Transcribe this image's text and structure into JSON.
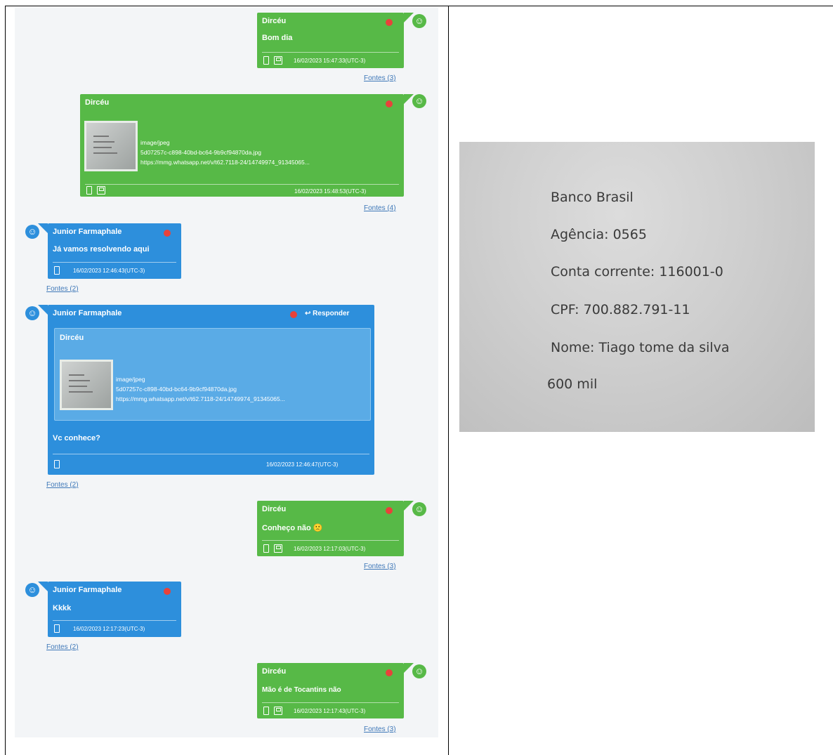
{
  "chat": {
    "messages": [
      {
        "sender": "Dircéu",
        "text": "Bom dia",
        "time": "16/02/2023 15:47:33(UTC-3)",
        "fontes": "Fontes (3)"
      },
      {
        "sender": "Dircéu",
        "attachment": {
          "type": "image/jpeg",
          "filename": "5d07257c-c898-40bd-bc64-9b9cf94870da.jpg",
          "url": "https://mmg.whatsapp.net/v/t62.7118-24/14749974_91345065..."
        },
        "time": "16/02/2023 15:48:53(UTC-3)",
        "fontes": "Fontes (4)"
      },
      {
        "sender": "Junior Farmaphale",
        "text": "Já vamos resolvendo aqui",
        "time": "16/02/2023 12:46:43(UTC-3)",
        "fontes": "Fontes (2)"
      },
      {
        "sender": "Junior Farmaphale",
        "reply_label": "Responder",
        "quoted_sender": "Dircéu",
        "attachment": {
          "type": "image/jpeg",
          "filename": "5d07257c-c898-40bd-bc64-9b9cf94870da.jpg",
          "url": "https://mmg.whatsapp.net/v/t62.7118-24/14749974_91345065..."
        },
        "text": "Vc conhece?",
        "time": "16/02/2023 12:46:47(UTC-3)",
        "fontes": "Fontes (2)"
      },
      {
        "sender": "Dircéu",
        "text": "Conheço não 🙁",
        "time": "16/02/2023 12:17:03(UTC-3)",
        "fontes": "Fontes (3)"
      },
      {
        "sender": "Junior Farmaphale",
        "text": "Kkkk",
        "time": "16/02/2023 12:17:23(UTC-3)",
        "fontes": "Fontes (2)"
      },
      {
        "sender": "Dircéu",
        "text": "Mão é de Tocantins não",
        "time": "16/02/2023 12:17:43(UTC-3)",
        "fontes": "Fontes (3)"
      }
    ]
  },
  "document": {
    "lines": [
      "Banco Brasil",
      "Agência: 0565",
      "Conta corrente: 116001-0",
      "CPF: 700.882.791-11",
      "Nome: Tiago tome da silva",
      "600 mil"
    ]
  },
  "colors": {
    "outgoing": "#57b947",
    "incoming": "#2d8fdc",
    "status_dot": "#e8423a",
    "link": "#3f78b8"
  },
  "icons": [
    "avatar-icon",
    "status-dot-icon",
    "phone-icon",
    "save-icon",
    "reply-icon"
  ]
}
